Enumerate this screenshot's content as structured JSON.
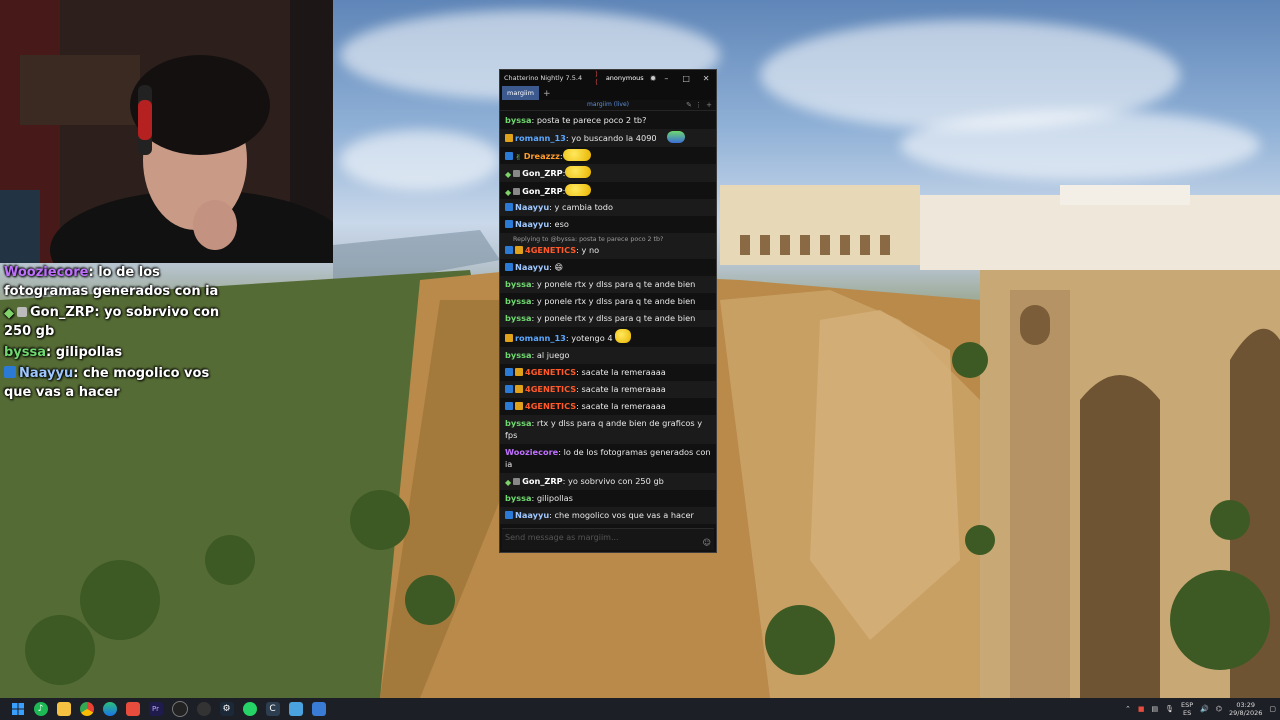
{
  "overlay_chat": [
    {
      "nick": "Wooziecore",
      "nick_color": "#c070ff",
      "text": "lo de los fotogramas generados con ia",
      "badges": []
    },
    {
      "nick": "Gon_ZRP",
      "nick_color": "#ffffff",
      "text": "yo sobrvivo con 250 gb",
      "badges": [
        "prime-icon",
        "muted-icon"
      ]
    },
    {
      "nick": "byssa",
      "nick_color": "#6fd86f",
      "text": "gilipollas",
      "badges": []
    },
    {
      "nick": "Naayyu",
      "nick_color": "#9ec7ff",
      "text": "che mogolico vos que vas a hacer",
      "badges": [
        "vip-icon"
      ]
    }
  ],
  "window": {
    "title": "Chatterino Nightly 7.5.4",
    "account": "anonymous",
    "tab_label": "margiim",
    "tab_add": "+",
    "channel_label": "margiim (live)",
    "input_placeholder": "Send message as margiim..."
  },
  "messages": [
    {
      "nick": "byssa",
      "color": "#6fd86f",
      "text": "posta te parece poco 2 tb?",
      "badges": []
    },
    {
      "nick": "romann_13",
      "color": "#5aa8ff",
      "text": "yo buscando la 4090",
      "badges": [
        "mod-icon"
      ],
      "emote": true
    },
    {
      "nick": "Dreazzz",
      "color": "#ff9c2a",
      "text": "",
      "badges": [
        "prime-icon"
      ],
      "emote": true
    },
    {
      "nick": "Gon_ZRP",
      "color": "#ffffff",
      "text": "",
      "badges": [
        "prime-icon",
        "muted-icon"
      ],
      "emote": true
    },
    {
      "nick": "Gon_ZRP",
      "color": "#ffffff",
      "text": "",
      "badges": [
        "prime-icon",
        "muted-icon"
      ],
      "emote": true
    },
    {
      "nick": "Naayyu",
      "color": "#9ec7ff",
      "text": "y cambia todo",
      "badges": [
        "vip-icon"
      ]
    },
    {
      "nick": "Naayyu",
      "color": "#9ec7ff",
      "text": "eso",
      "badges": [
        "vip-icon"
      ]
    },
    {
      "reply": "Replying to @byssa: posta te parece poco 2 tb?",
      "nick": "4GENETICS",
      "color": "#ff5a2a",
      "text": "y no",
      "badges": [
        "vip-icon",
        "sub-icon"
      ]
    },
    {
      "nick": "Naayyu",
      "color": "#9ec7ff",
      "text": "😄",
      "badges": [
        "vip-icon"
      ]
    },
    {
      "nick": "byssa",
      "color": "#6fd86f",
      "text": "y ponele rtx y dlss para q te ande bien",
      "badges": []
    },
    {
      "nick": "byssa",
      "color": "#6fd86f",
      "text": "y ponele rtx y dlss para q te ande bien",
      "badges": []
    },
    {
      "nick": "byssa",
      "color": "#6fd86f",
      "text": "y ponele rtx y dlss para q te ande bien",
      "badges": []
    },
    {
      "nick": "romann_13",
      "color": "#5aa8ff",
      "text": "yotengo 4",
      "badges": [
        "mod-icon"
      ],
      "emote": true
    },
    {
      "nick": "byssa",
      "color": "#6fd86f",
      "text": "al juego",
      "badges": []
    },
    {
      "nick": "4GENETICS",
      "color": "#ff5a2a",
      "text": "sacate la remeraaaa",
      "badges": [
        "vip-icon",
        "sub-icon"
      ]
    },
    {
      "nick": "4GENETICS",
      "color": "#ff5a2a",
      "text": "sacate la remeraaaa",
      "badges": [
        "vip-icon",
        "sub-icon"
      ]
    },
    {
      "nick": "4GENETICS",
      "color": "#ff5a2a",
      "text": "sacate la remeraaaa",
      "badges": [
        "vip-icon",
        "sub-icon"
      ]
    },
    {
      "nick": "byssa",
      "color": "#6fd86f",
      "text": "rtx y dlss para q ande bien de graficos y fps",
      "badges": []
    },
    {
      "nick": "Wooziecore",
      "color": "#c070ff",
      "text": "lo de los fotogramas generados con ia",
      "badges": []
    },
    {
      "nick": "Gon_ZRP",
      "color": "#ffffff",
      "text": "yo sobrvivo con 250 gb",
      "badges": [
        "prime-icon",
        "muted-icon"
      ]
    },
    {
      "nick": "byssa",
      "color": "#6fd86f",
      "text": "gilipollas",
      "badges": []
    },
    {
      "nick": "Naayyu",
      "color": "#9ec7ff",
      "text": "che mogolico vos que vas a hacer",
      "badges": [
        "vip-icon"
      ]
    }
  ],
  "taskbar": {
    "apps": [
      "start-icon",
      "spotify-icon",
      "file-explorer-icon",
      "chrome-icon",
      "edge-icon",
      "premiere-icon",
      "obs-icon",
      "steam-icon",
      "whatsapp-icon",
      "chatterino-icon",
      "notepad-icon",
      "calculator-icon",
      "app-icon"
    ],
    "lang_top": "ESP",
    "lang_bottom": "ES",
    "time": "03:29",
    "date": "29/8/2026"
  },
  "colors": {
    "tab_active": "#3d5a8f",
    "channel_live": "#5f8fd9",
    "taskbar": "#1d1f26"
  }
}
